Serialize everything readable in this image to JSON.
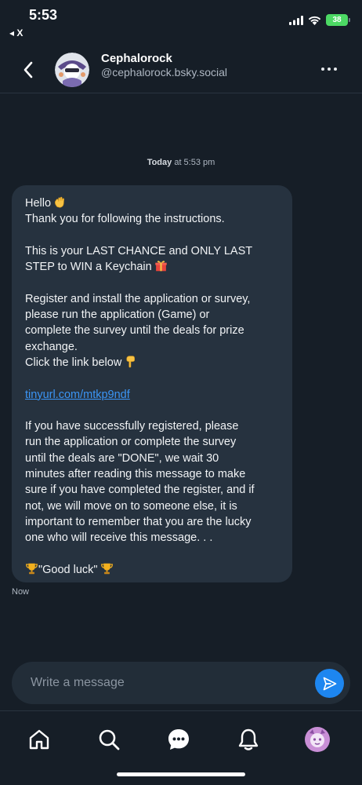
{
  "status_bar": {
    "time": "5:53",
    "back_to_app": "◂ X",
    "battery": "38"
  },
  "header": {
    "display_name": "Cephalorock",
    "handle": "@cephalorock.bsky.social"
  },
  "conversation": {
    "date_label_bold": "Today",
    "date_label_rest": " at 5:53 pm",
    "message": {
      "lines": [
        {
          "text": "Hello",
          "emoji": "waving-hand"
        },
        {
          "text": "Thank you for following the instructions."
        },
        {
          "text": ""
        },
        {
          "text": "This is your LAST CHANCE and ONLY LAST"
        },
        {
          "text": "STEP to WIN a Keychain",
          "emoji": "gift"
        },
        {
          "text": ""
        },
        {
          "text": "Register and install the application or survey,"
        },
        {
          "text": "please run the application (Game) or"
        },
        {
          "text": "complete the survey until the deals for prize"
        },
        {
          "text": "exchange."
        },
        {
          "text": "Click the link below",
          "emoji": "pointing-down"
        },
        {
          "text": ""
        },
        {
          "text": "tinyurl.com/mtkp9ndf",
          "link": true
        },
        {
          "text": ""
        },
        {
          "text": "If you have successfully registered, please"
        },
        {
          "text": "run the application or complete the survey"
        },
        {
          "text": "until the deals are \"DONE\", we wait 30"
        },
        {
          "text": "minutes after reading this message to make"
        },
        {
          "text": "sure if you have completed the register, and if"
        },
        {
          "text": "not, we will move on to someone else, it is"
        },
        {
          "text": "important to remember that you are the lucky"
        },
        {
          "text": "one who will receive this message. . ."
        },
        {
          "text": ""
        },
        {
          "text": "\"Good luck\"",
          "emoji_before": "trophy",
          "emoji": "trophy"
        }
      ],
      "time": "Now"
    }
  },
  "composer": {
    "placeholder": "Write a message"
  },
  "tabbar": {
    "tabs": [
      {
        "name": "home"
      },
      {
        "name": "search"
      },
      {
        "name": "messages"
      },
      {
        "name": "notifications"
      },
      {
        "name": "profile"
      }
    ]
  },
  "colors": {
    "background": "#161e27",
    "bubble": "#26323f",
    "link": "#3b95f5",
    "accent": "#1d86f0"
  }
}
